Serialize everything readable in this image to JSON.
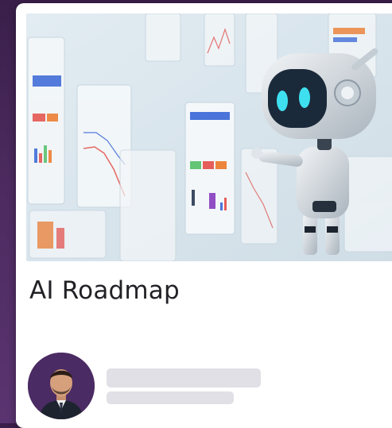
{
  "card": {
    "title": "AI Roadmap",
    "image": {
      "subject": "robot-touching-dashboard-screens",
      "colors": {
        "background": "#dce8ef",
        "panel": "#f4f7f9",
        "robot_body": "#e8ecef",
        "robot_visor": "#1b2a3a",
        "robot_eyes": "#3ee0f0",
        "accent_orange": "#f07a2a",
        "accent_blue": "#3b68d8",
        "accent_green": "#57c26a",
        "accent_red": "#e8504a"
      }
    },
    "author": {
      "avatar_icon": "person-avatar-icon",
      "avatar_background": "#4b2b63",
      "name_placeholder": "",
      "meta_placeholder": ""
    }
  },
  "colors": {
    "page_background": "#4a2a5c",
    "card_background": "#ffffff",
    "title_text": "#222226",
    "skeleton": "#e0e0e6"
  }
}
